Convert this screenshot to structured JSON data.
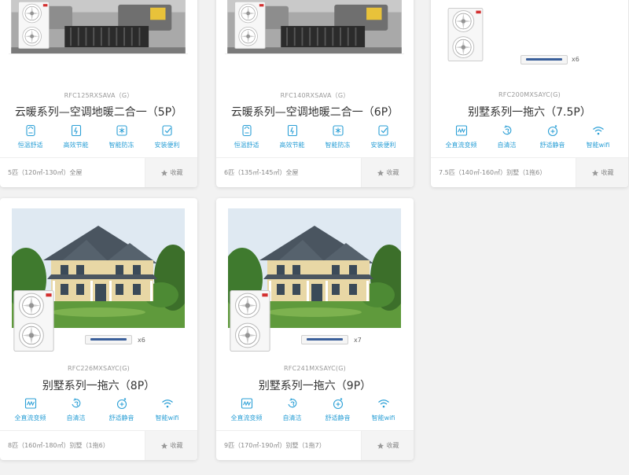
{
  "favorite_label": "收藏",
  "colors": {
    "accent": "#2a9fd6",
    "footer_bg": "#f4f4f4",
    "page_bg": "#f2f2f2"
  },
  "products": [
    {
      "model": "RFC125RXSAVA（G）",
      "name": "云暖系列—空调地暖二合一（5P）",
      "features": [
        {
          "icon": "thermostat-icon",
          "label": "恒温舒适"
        },
        {
          "icon": "energy-saving-icon",
          "label": "高效节能"
        },
        {
          "icon": "anti-freeze-icon",
          "label": "智能防冻"
        },
        {
          "icon": "easy-install-icon",
          "label": "安装便利"
        }
      ],
      "spec": "5匹（120㎡-130㎡）全屋"
    },
    {
      "model": "RFC140RXSAVA（G）",
      "name": "云暖系列—空调地暖二合一（6P）",
      "features": [
        {
          "icon": "thermostat-icon",
          "label": "恒温舒适"
        },
        {
          "icon": "energy-saving-icon",
          "label": "高效节能"
        },
        {
          "icon": "anti-freeze-icon",
          "label": "智能防冻"
        },
        {
          "icon": "easy-install-icon",
          "label": "安装便利"
        }
      ],
      "spec": "6匹（135㎡-145㎡）全屋"
    },
    {
      "model": "RFC200MXSAYC(G)",
      "name": "别墅系列一拖六（7.5P）",
      "indoor_count": "x6",
      "features": [
        {
          "icon": "dc-inverter-icon",
          "label": "全直流变频"
        },
        {
          "icon": "self-clean-icon",
          "label": "自清洁"
        },
        {
          "icon": "quiet-icon",
          "label": "舒适静音"
        },
        {
          "icon": "wifi-icon",
          "label": "智能wifi"
        }
      ],
      "spec": "7.5匹（140㎡-160㎡）别墅（1拖6）"
    },
    {
      "model": "RFC226MXSAYC(G)",
      "name": "别墅系列一拖六（8P）",
      "indoor_count": "x6",
      "features": [
        {
          "icon": "dc-inverter-icon",
          "label": "全直流变频"
        },
        {
          "icon": "self-clean-icon",
          "label": "自清洁"
        },
        {
          "icon": "quiet-icon",
          "label": "舒适静音"
        },
        {
          "icon": "wifi-icon",
          "label": "智能wifi"
        }
      ],
      "spec": "8匹（160㎡-180㎡）别墅（1拖6）"
    },
    {
      "model": "RFC241MXSAYC(G)",
      "name": "别墅系列一拖六（9P）",
      "indoor_count": "x7",
      "features": [
        {
          "icon": "dc-inverter-icon",
          "label": "全直流变频"
        },
        {
          "icon": "self-clean-icon",
          "label": "自清洁"
        },
        {
          "icon": "quiet-icon",
          "label": "舒适静音"
        },
        {
          "icon": "wifi-icon",
          "label": "智能wifi"
        }
      ],
      "spec": "9匹（170㎡-190㎡）别墅（1拖7）"
    }
  ]
}
